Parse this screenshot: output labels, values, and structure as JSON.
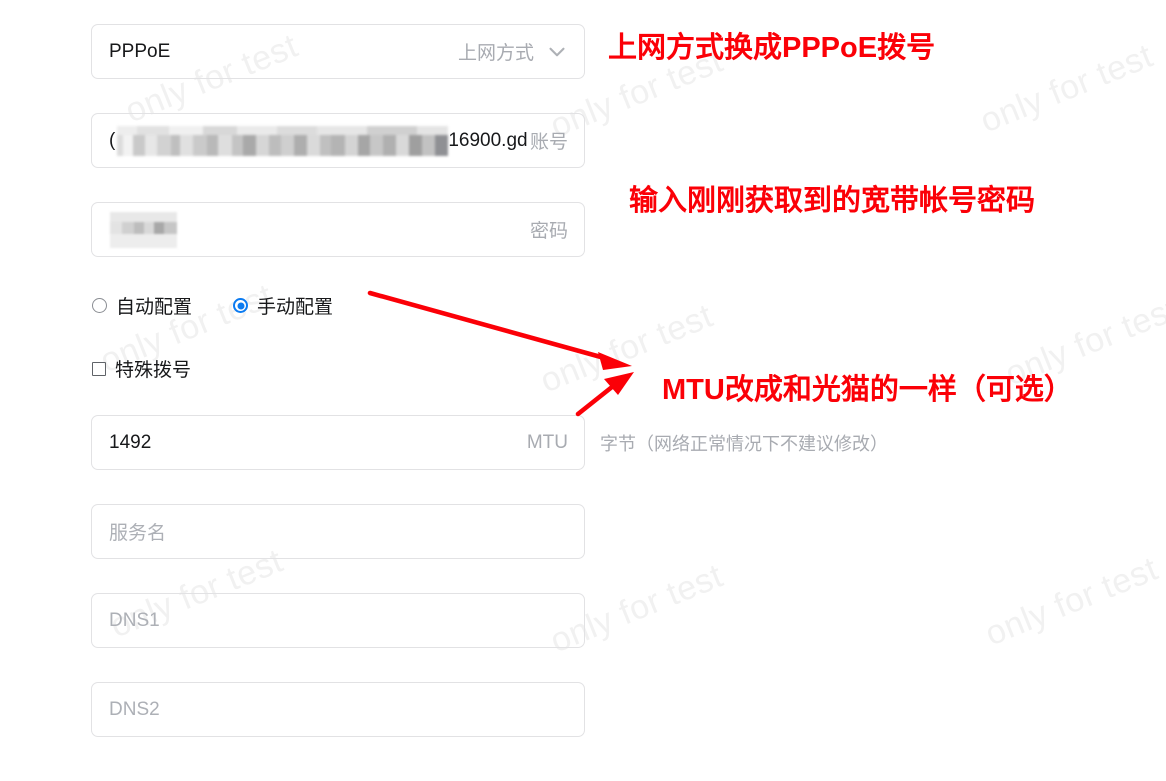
{
  "form": {
    "connection_type": {
      "value": "PPPoE",
      "suffix_label": "上网方式",
      "icon": "chevron-down-icon"
    },
    "account": {
      "value_visible_tail": "16900.gd",
      "value_redacted": true,
      "suffix_label": "账号"
    },
    "password": {
      "value_redacted": true,
      "suffix_label": "密码"
    },
    "config_mode": {
      "auto_label": "自动配置",
      "auto_selected": false,
      "manual_label": "手动配置",
      "manual_selected": true,
      "selected_color": "#0b7bf1"
    },
    "special_dial": {
      "label": "特殊拨号",
      "checked": false
    },
    "mtu": {
      "value": "1492",
      "suffix_label": "MTU",
      "hint": "字节（网络正常情况下不建议修改）"
    },
    "service_name": {
      "placeholder": "服务名",
      "value": ""
    },
    "dns1": {
      "placeholder": "DNS1",
      "value": ""
    },
    "dns2": {
      "placeholder": "DNS2",
      "value": ""
    }
  },
  "annotations": {
    "color": "#fb0007",
    "note_1": "上网方式换成PPPoE拨号",
    "note_2": "输入刚刚获取到的宽带帐号密码",
    "note_3": "MTU改成和光猫的一样（可选）"
  },
  "watermark": {
    "text": "only for test",
    "color": "#f1f1f1"
  }
}
